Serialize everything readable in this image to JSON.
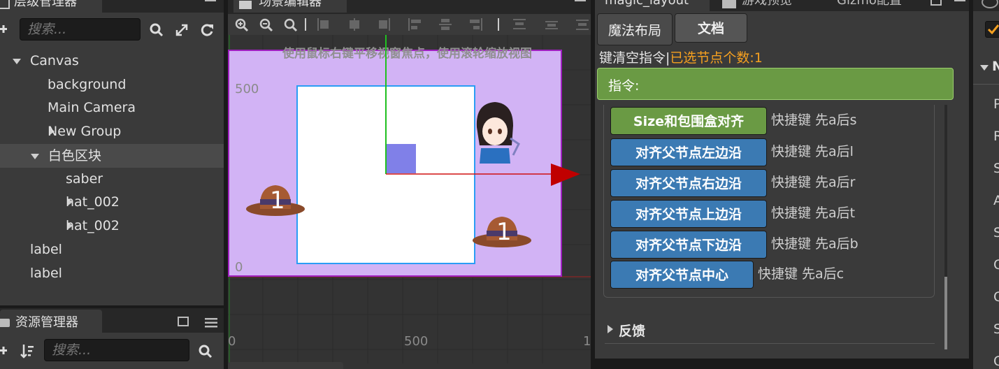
{
  "hierarchy": {
    "title": "层级管理器",
    "search_placeholder": "搜索...",
    "items": [
      {
        "label": "Canvas",
        "expand": "down"
      },
      {
        "label": "background",
        "expand": "none"
      },
      {
        "label": "Main Camera",
        "expand": "none"
      },
      {
        "label": "New Group",
        "expand": "right"
      },
      {
        "label": "白色区块",
        "expand": "down",
        "selected": true
      },
      {
        "label": "saber",
        "expand": "none"
      },
      {
        "label": "hat_002",
        "expand": "right"
      },
      {
        "label": "hat_002",
        "expand": "right"
      },
      {
        "label": "label",
        "expand": "none"
      },
      {
        "label": "label",
        "expand": "none"
      }
    ]
  },
  "assets": {
    "title": "资源管理器",
    "search_placeholder": "搜索..."
  },
  "scene": {
    "title": "场景编辑器",
    "hint": "使用鼠标右键平移视窗焦点，使用滚轮缩放视图",
    "ruler_y_top": "500",
    "ruler_y_bottom": "0",
    "ruler_x_left": "0",
    "ruler_x_mid": "500",
    "ruler_x_right": "1",
    "hat_label": "1",
    "colors": {
      "canvas_bg": "#d2b3f5",
      "canvas_border": "#a020c0",
      "grid_bg": "#333333",
      "x_axis": "#d01010",
      "y_axis": "#20c020",
      "selection": "#2a9df4"
    }
  },
  "magic": {
    "tabs": [
      {
        "label": "magic_layout",
        "active": true
      },
      {
        "label": "游戏预览",
        "active": false
      },
      {
        "label": "Gizmo配置",
        "active": false
      }
    ],
    "subtabs": [
      "魔法布局",
      "文档"
    ],
    "status_prefix": "键清空指令|",
    "status_count": "已选节点个数:1",
    "command_label": "指令:",
    "buttons": [
      {
        "label": "Size和包围盒对齐",
        "hint": "快捷键 先a后s",
        "color": "#6a9a44"
      },
      {
        "label": "对齐父节点左边沿",
        "hint": "快捷键 先a后l",
        "color": "#3b7ab3"
      },
      {
        "label": "对齐父节点右边沿",
        "hint": "快捷键 先a后r",
        "color": "#3b7ab3"
      },
      {
        "label": "对齐父节点上边沿",
        "hint": "快捷键 先a后t",
        "color": "#3b7ab3"
      },
      {
        "label": "对齐父节点下边沿",
        "hint": "快捷键 先a后b",
        "color": "#3b7ab3"
      },
      {
        "label": "对齐父节点中心",
        "hint": "快捷键 先a后c",
        "color": "#3b7ab3"
      }
    ],
    "feedback_label": "反馈",
    "colors": {
      "command_bar": "#6a9a44",
      "status_count": "#f5a020"
    }
  },
  "inspector": {
    "section_letter": "N",
    "rows": [
      "P",
      "R",
      "S",
      "A",
      "S",
      "C",
      "C",
      "S",
      "C"
    ]
  }
}
